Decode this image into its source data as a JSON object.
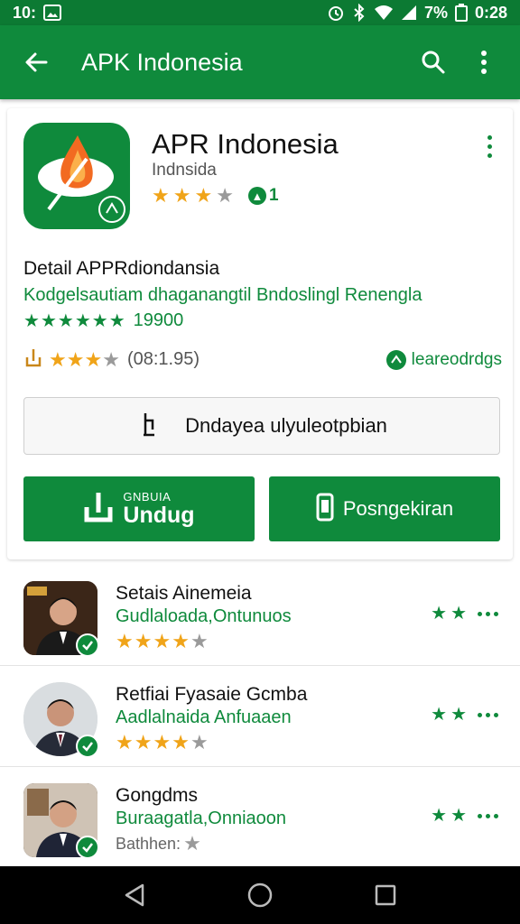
{
  "status_bar": {
    "time_left": "10:",
    "battery": "7%",
    "time_right": "0:28",
    "icons": [
      "image-icon",
      "alarm-icon",
      "bluetooth-icon",
      "wifi-icon",
      "signal-icon",
      "battery-icon"
    ]
  },
  "app_bar": {
    "title": "APK Indonesia",
    "icons": [
      "back-arrow-icon",
      "search-icon",
      "more-vert-icon"
    ]
  },
  "app_card": {
    "name": "APR Indonesia",
    "developer": "Indnsida",
    "rating_stars": 2.5,
    "badge_count": "1",
    "detail_title": "Detail APPRdiondansia",
    "detail_desc": "Kodgelsautiam dhaganangtil Bndoslingl Renengla",
    "detail_stars": 6,
    "detail_count": "19900",
    "review_stars": 3,
    "review_count": "(08:1.95)",
    "review_link": "leareodrdgs",
    "outline_button": "Dndayea ulyuleotpbian",
    "download_small": "GNBUIA",
    "download_label": "Undug",
    "second_button": "Posngekiran"
  },
  "list_items": [
    {
      "name": "Setais Ainemeia",
      "subtitle": "Gudlaloada,Ontunuos",
      "stars": 3.5,
      "stars_label": "",
      "trail_stars": 2,
      "avatar": "square"
    },
    {
      "name": "Retfiai Fyasaie Gcmba",
      "subtitle": "Aadlalnaida Anfuaaen",
      "stars": 3.5,
      "stars_label": "",
      "trail_stars": 2,
      "avatar": "circle"
    },
    {
      "name": "Gongdms",
      "subtitle": "Buraagatla,Onniaoon",
      "stars": 1,
      "stars_label": "Bathhen:",
      "trail_stars": 2,
      "avatar": "square"
    }
  ],
  "colors": {
    "primary": "#0f8a3c",
    "status_bar": "#0c7a33",
    "star": "#f0a419"
  }
}
